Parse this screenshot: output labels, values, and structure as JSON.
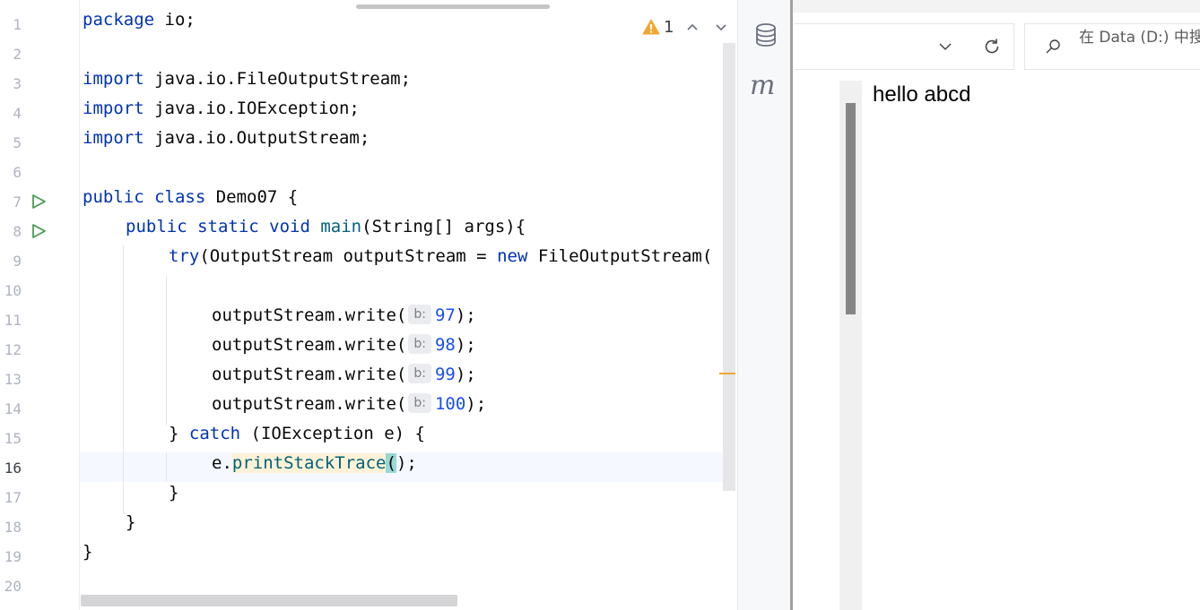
{
  "editor": {
    "line_numbers": [
      "1",
      "2",
      "3",
      "4",
      "5",
      "6",
      "7",
      "8",
      "9",
      "10",
      "11",
      "12",
      "13",
      "14",
      "15",
      "16",
      "17",
      "18",
      "19",
      "20"
    ],
    "current_line": "16",
    "inspection": {
      "count": "1"
    },
    "code": {
      "l1_kw": "package",
      "l1_rest": " io;",
      "l3_kw": "import",
      "l3_rest": " java.io.FileOutputStream;",
      "l4_kw": "import",
      "l4_rest": " java.io.IOException;",
      "l5_kw": "import",
      "l5_rest": " java.io.OutputStream;",
      "l7_kw": "public class",
      "l7_rest": " Demo07 {",
      "l8_kw": "public static void",
      "l8_fn": "main",
      "l8_rest": "(String[] args){",
      "l9_kw": "try",
      "l9_mid": "(OutputStream outputStream = ",
      "l9_kw2": "new",
      "l9_rest": " FileOutputStream(",
      "write_call": "outputStream.write(",
      "hint_label": "b:",
      "l11_num": "97",
      "l12_num": "98",
      "l13_num": "99",
      "l14_num": "100",
      "close_stmt": ");",
      "l15_a": "} ",
      "l15_kw": "catch",
      "l15_rest": " (IOException e) {",
      "l16_a": "e.",
      "l16_id": "printStackTrace",
      "l16_paren_open": "(",
      "l16_paren_close": ")",
      "l16_end": ";",
      "l17": "}",
      "l18": "}",
      "l19": "}"
    }
  },
  "toolstrip": {
    "maven_label": "m"
  },
  "explorer": {
    "search_placeholder": "在 Data (D:) 中搜"
  },
  "notepad": {
    "content": "hello abcd"
  },
  "colors": {
    "keyword": "#0033b3",
    "number": "#1750eb",
    "function": "#00627a",
    "run_icon": "#499c54",
    "warning": "#f0a732"
  }
}
